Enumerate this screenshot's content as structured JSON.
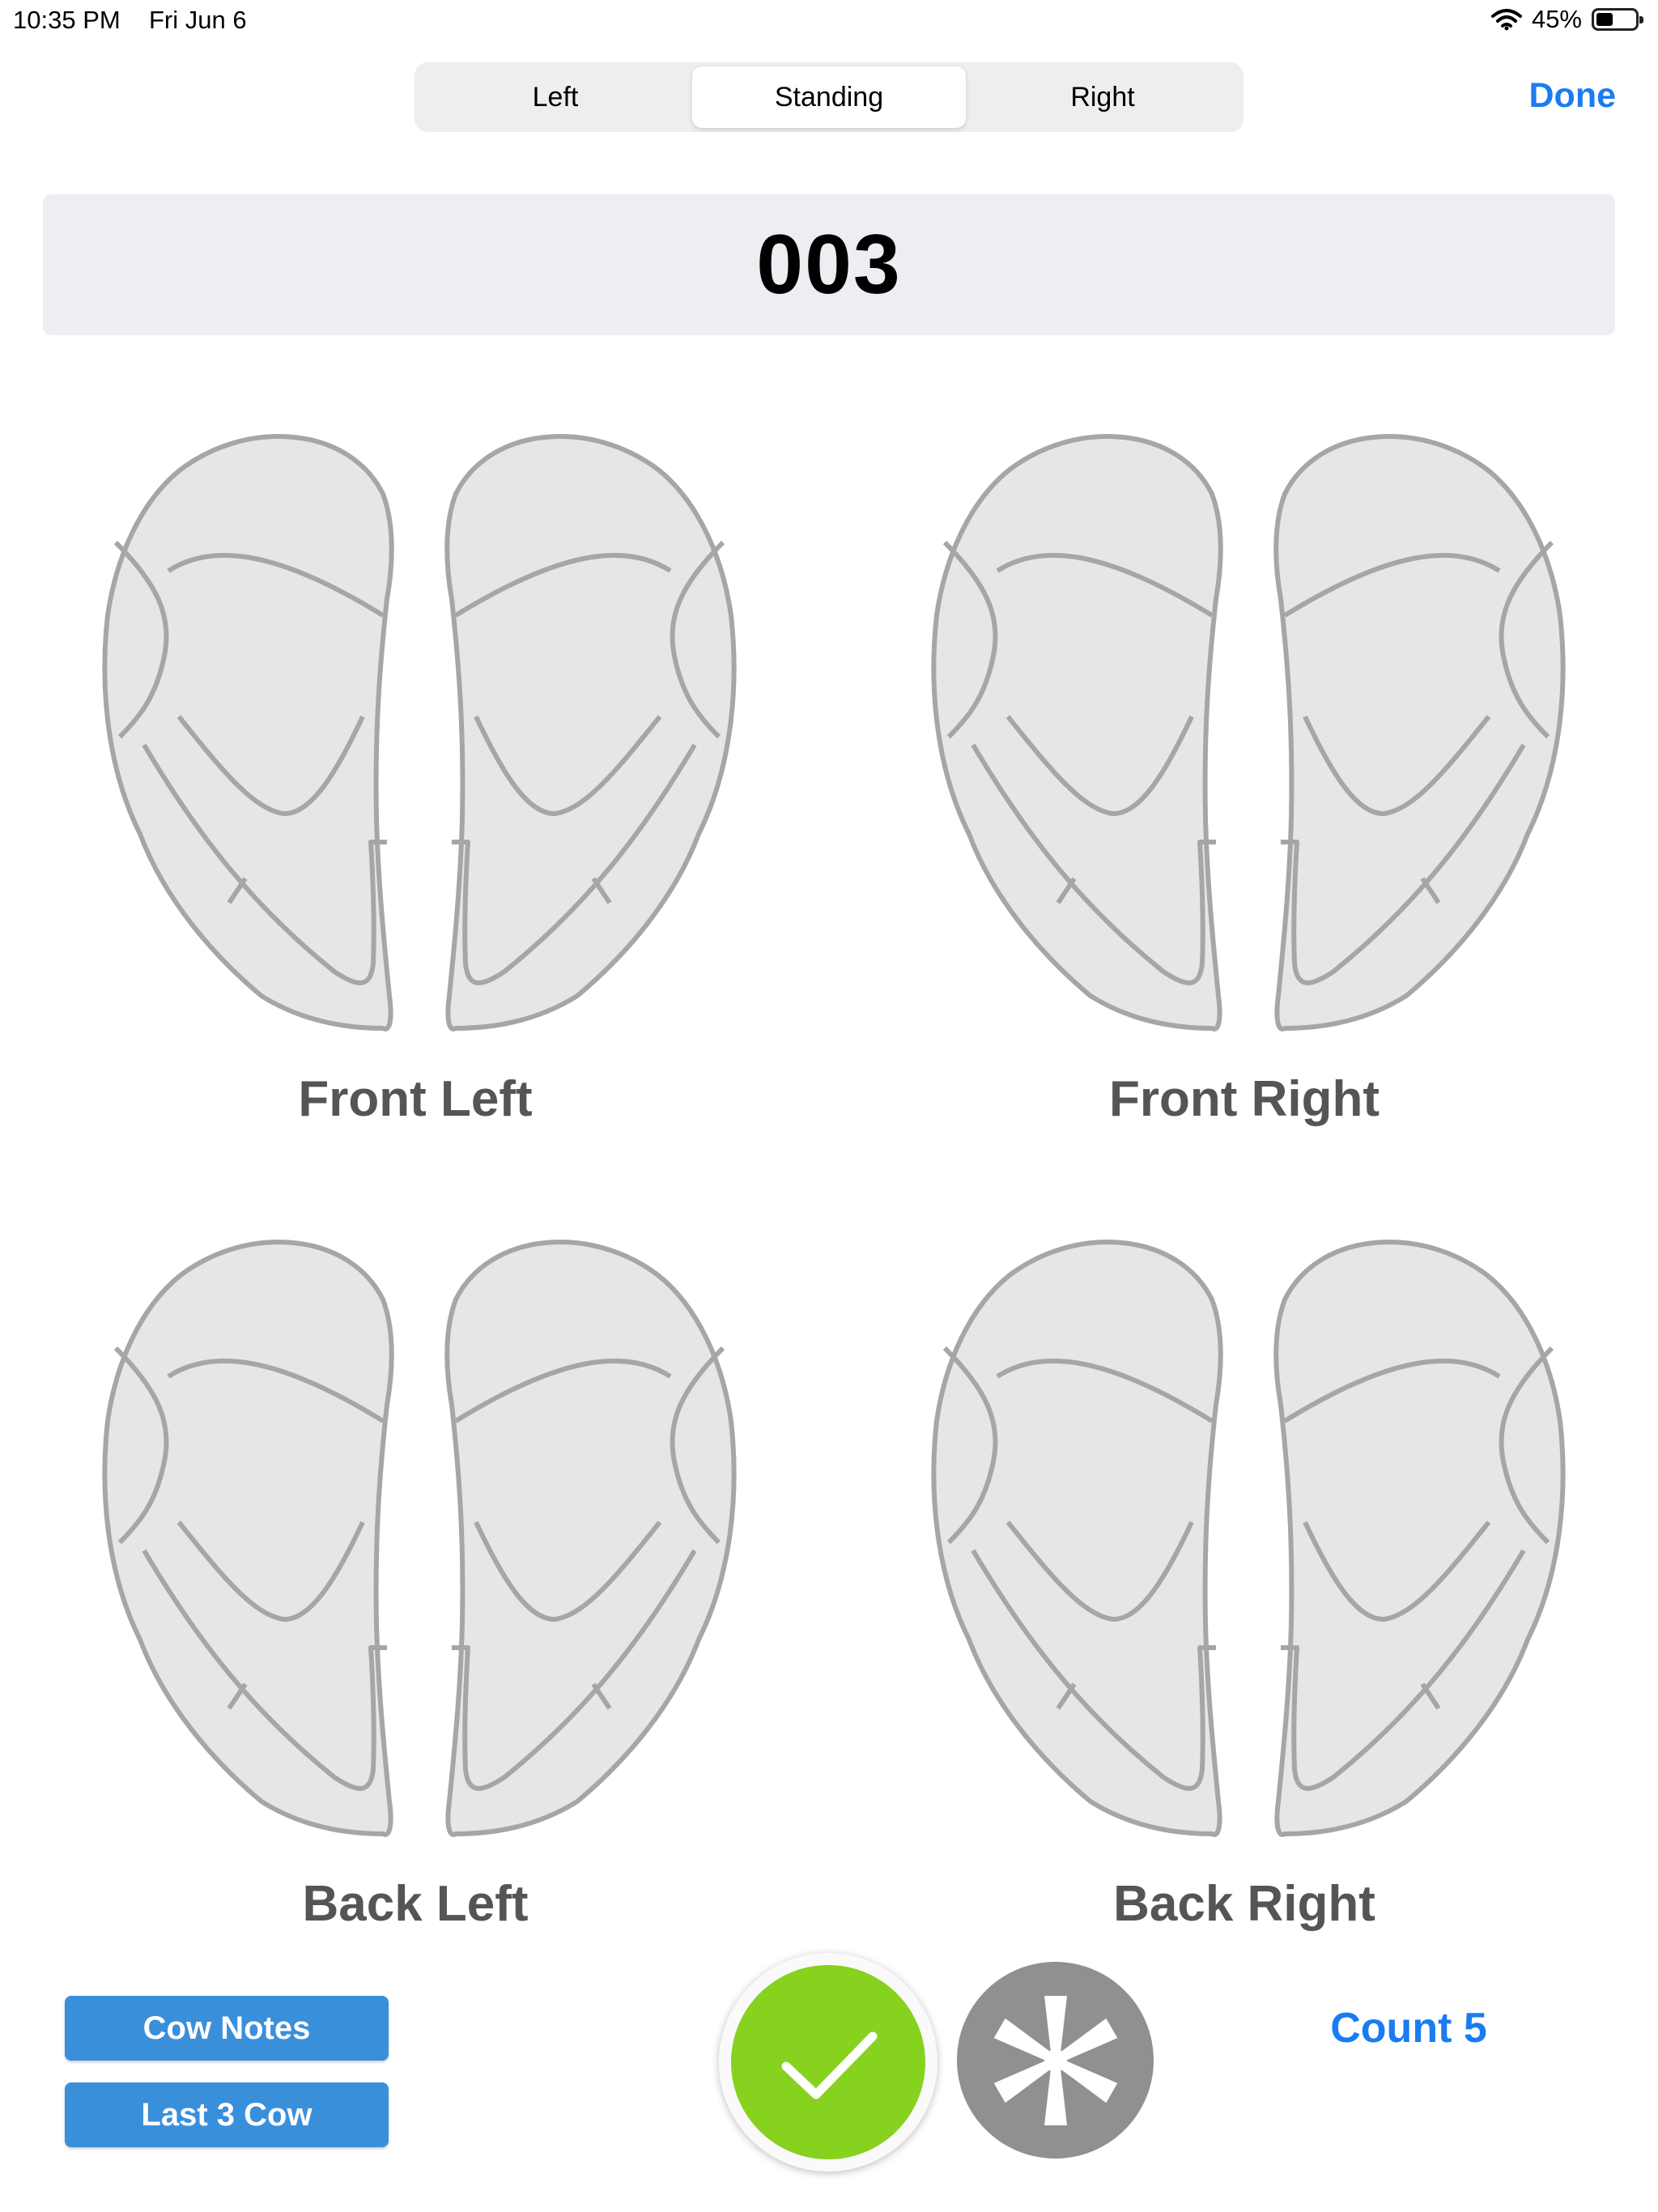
{
  "status_bar": {
    "time": "10:35 PM",
    "date": "Fri Jun 6",
    "battery": "45%"
  },
  "segments": [
    {
      "label": "Left",
      "active": false
    },
    {
      "label": "Standing",
      "active": true
    },
    {
      "label": "Right",
      "active": false
    }
  ],
  "done_label": "Done",
  "cow_id": "003",
  "quarters": [
    {
      "label": "Front Left"
    },
    {
      "label": "Front Right"
    },
    {
      "label": "Back Left"
    },
    {
      "label": "Back Right"
    }
  ],
  "buttons": {
    "cow_notes": "Cow Notes",
    "last_3_cow": "Last 3 Cow"
  },
  "count_label": "Count 5",
  "colors": {
    "accent": "#1a7cf0",
    "button_blue": "#3a8fdb",
    "confirm_green": "#87d11f",
    "asterisk_gray": "#909090",
    "udder_fill": "#e6e6e6",
    "udder_stroke": "#a6a6a6"
  },
  "icons": {
    "confirm": "checkmark-icon",
    "other": "asterisk-icon",
    "udder": "udder-diagram-icon"
  }
}
